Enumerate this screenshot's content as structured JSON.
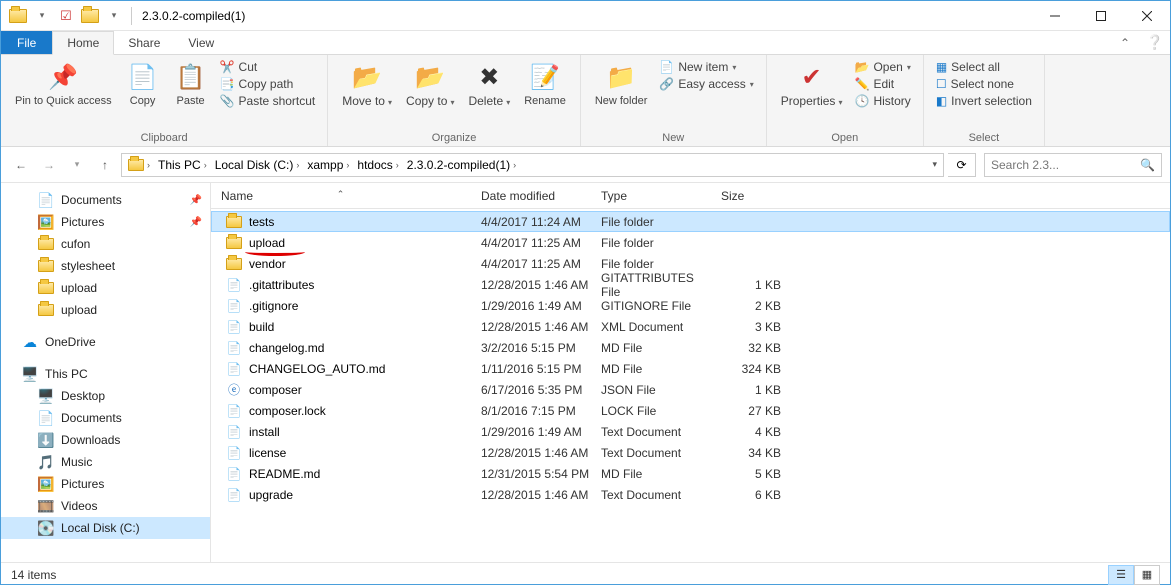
{
  "window": {
    "title": "2.3.0.2-compiled(1)"
  },
  "tabs": {
    "file": "File",
    "home": "Home",
    "share": "Share",
    "view": "View"
  },
  "ribbon": {
    "clipboard": {
      "label": "Clipboard",
      "pin": "Pin to Quick access",
      "copy": "Copy",
      "paste": "Paste",
      "cut": "Cut",
      "copypath": "Copy path",
      "paste_shortcut": "Paste shortcut"
    },
    "organize": {
      "label": "Organize",
      "moveto": "Move to",
      "copyto": "Copy to",
      "delete": "Delete",
      "rename": "Rename"
    },
    "new": {
      "label": "New",
      "newfolder": "New folder",
      "newitem": "New item",
      "easyaccess": "Easy access"
    },
    "open": {
      "label": "Open",
      "properties": "Properties",
      "open": "Open",
      "edit": "Edit",
      "history": "History"
    },
    "select": {
      "label": "Select",
      "all": "Select all",
      "none": "Select none",
      "invert": "Invert selection"
    }
  },
  "breadcrumb": [
    "This PC",
    "Local Disk (C:)",
    "xampp",
    "htdocs",
    "2.3.0.2-compiled(1)"
  ],
  "search": {
    "placeholder": "Search 2.3..."
  },
  "tree": {
    "quick": [
      {
        "label": "Documents",
        "icon": "doc",
        "pinned": true
      },
      {
        "label": "Pictures",
        "icon": "pic",
        "pinned": true
      },
      {
        "label": "cufon",
        "icon": "folder"
      },
      {
        "label": "stylesheet",
        "icon": "folder"
      },
      {
        "label": "upload",
        "icon": "folder"
      },
      {
        "label": "upload",
        "icon": "folder"
      }
    ],
    "onedrive": "OneDrive",
    "thispc": "This PC",
    "pcitems": [
      {
        "label": "Desktop",
        "icon": "desktop"
      },
      {
        "label": "Documents",
        "icon": "doc"
      },
      {
        "label": "Downloads",
        "icon": "down"
      },
      {
        "label": "Music",
        "icon": "music"
      },
      {
        "label": "Pictures",
        "icon": "pic"
      },
      {
        "label": "Videos",
        "icon": "video"
      },
      {
        "label": "Local Disk (C:)",
        "icon": "disk",
        "selected": true
      }
    ]
  },
  "columns": {
    "name": "Name",
    "date": "Date modified",
    "type": "Type",
    "size": "Size"
  },
  "files": [
    {
      "name": "tests",
      "date": "4/4/2017 11:24 AM",
      "type": "File folder",
      "size": "",
      "icon": "folder",
      "selected": true
    },
    {
      "name": "upload",
      "date": "4/4/2017 11:25 AM",
      "type": "File folder",
      "size": "",
      "icon": "folder",
      "annotated": true
    },
    {
      "name": "vendor",
      "date": "4/4/2017 11:25 AM",
      "type": "File folder",
      "size": "",
      "icon": "folder"
    },
    {
      "name": ".gitattributes",
      "date": "12/28/2015 1:46 AM",
      "type": "GITATTRIBUTES File",
      "size": "1 KB",
      "icon": "file"
    },
    {
      "name": ".gitignore",
      "date": "1/29/2016 1:49 AM",
      "type": "GITIGNORE File",
      "size": "2 KB",
      "icon": "file"
    },
    {
      "name": "build",
      "date": "12/28/2015 1:46 AM",
      "type": "XML Document",
      "size": "3 KB",
      "icon": "file"
    },
    {
      "name": "changelog.md",
      "date": "3/2/2016 5:15 PM",
      "type": "MD File",
      "size": "32 KB",
      "icon": "file"
    },
    {
      "name": "CHANGELOG_AUTO.md",
      "date": "1/11/2016 5:15 PM",
      "type": "MD File",
      "size": "324 KB",
      "icon": "file"
    },
    {
      "name": "composer",
      "date": "6/17/2016 5:35 PM",
      "type": "JSON File",
      "size": "1 KB",
      "icon": "ie"
    },
    {
      "name": "composer.lock",
      "date": "8/1/2016 7:15 PM",
      "type": "LOCK File",
      "size": "27 KB",
      "icon": "file"
    },
    {
      "name": "install",
      "date": "1/29/2016 1:49 AM",
      "type": "Text Document",
      "size": "4 KB",
      "icon": "txt"
    },
    {
      "name": "license",
      "date": "12/28/2015 1:46 AM",
      "type": "Text Document",
      "size": "34 KB",
      "icon": "txt"
    },
    {
      "name": "README.md",
      "date": "12/31/2015 5:54 PM",
      "type": "MD File",
      "size": "5 KB",
      "icon": "file"
    },
    {
      "name": "upgrade",
      "date": "12/28/2015 1:46 AM",
      "type": "Text Document",
      "size": "6 KB",
      "icon": "txt"
    }
  ],
  "status": {
    "count": "14 items"
  }
}
